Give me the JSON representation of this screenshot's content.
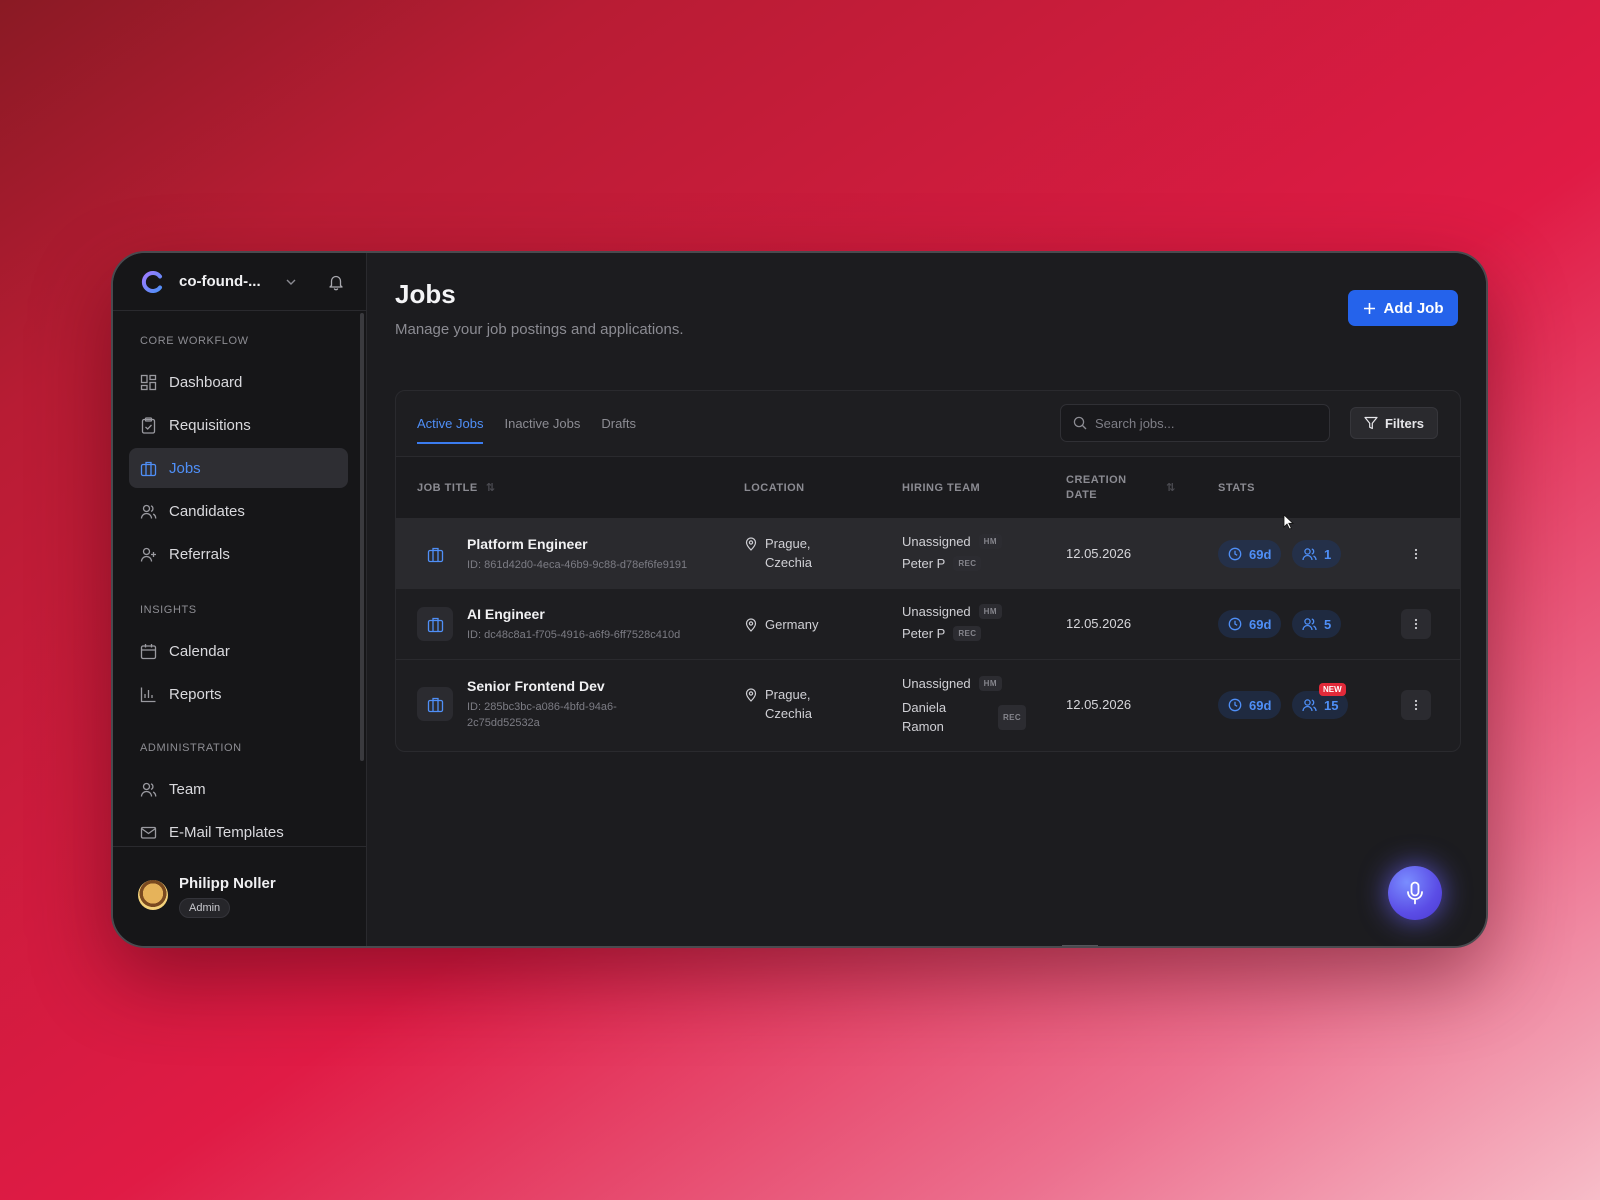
{
  "workspace": {
    "name": "co-found-..."
  },
  "sidebar": {
    "sections": [
      {
        "label": "CORE WORKFLOW",
        "items": [
          {
            "label": "Dashboard",
            "icon": "dashboard-icon"
          },
          {
            "label": "Requisitions",
            "icon": "clipboard-check-icon"
          },
          {
            "label": "Jobs",
            "icon": "briefcase-icon",
            "active": true
          },
          {
            "label": "Candidates",
            "icon": "users-icon"
          },
          {
            "label": "Referrals",
            "icon": "user-plus-icon"
          }
        ]
      },
      {
        "label": "INSIGHTS",
        "items": [
          {
            "label": "Calendar",
            "icon": "calendar-icon"
          },
          {
            "label": "Reports",
            "icon": "bar-chart-icon"
          }
        ]
      },
      {
        "label": "ADMINISTRATION",
        "items": [
          {
            "label": "Team",
            "icon": "user-icon"
          },
          {
            "label": "E-Mail Templates",
            "icon": "mail-icon"
          }
        ]
      }
    ]
  },
  "user": {
    "name": "Philipp Noller",
    "role": "Admin"
  },
  "header": {
    "title": "Jobs",
    "subtitle": "Manage your job postings and applications.",
    "add_button": "Add Job"
  },
  "tabs": [
    "Active Jobs",
    "Inactive Jobs",
    "Drafts"
  ],
  "search": {
    "placeholder": "Search jobs..."
  },
  "filters_label": "Filters",
  "table": {
    "columns": {
      "job_title": "JOB TITLE",
      "location": "LOCATION",
      "hiring_team": "HIRING TEAM",
      "creation_date_1": "CREATION",
      "creation_date_2": "DATE",
      "stats": "STATS"
    },
    "rows": [
      {
        "title": "Platform Engineer",
        "id_line1": "ID: 861d42d0-4eca-46b9-9c88-d78ef6fe9191",
        "id_line2": "",
        "location_line1": "Prague,",
        "location_line2": "Czechia",
        "hm_name": "Unassigned",
        "hm_tag": "HM",
        "rec_name1": "Peter P",
        "rec_name2": "",
        "rec_tag": "REC",
        "date": "12.05.2026",
        "days": "69d",
        "candidates": "1",
        "new": ""
      },
      {
        "title": "AI Engineer",
        "id_line1": "ID: dc48c8a1-f705-4916-a6f9-6ff7528c410d",
        "id_line2": "",
        "location_line1": "Germany",
        "location_line2": "",
        "hm_name": "Unassigned",
        "hm_tag": "HM",
        "rec_name1": "Peter P",
        "rec_name2": "",
        "rec_tag": "REC",
        "date": "12.05.2026",
        "days": "69d",
        "candidates": "5",
        "new": ""
      },
      {
        "title": "Senior Frontend Dev",
        "id_line1": "ID: 285bc3bc-a086-4bfd-94a6-",
        "id_line2": "2c75dd52532a",
        "location_line1": "Prague,",
        "location_line2": "Czechia",
        "hm_name": "Unassigned",
        "hm_tag": "HM",
        "rec_name1": "Daniela",
        "rec_name2": "Ramon",
        "rec_tag": "REC",
        "date": "12.05.2026",
        "days": "69d",
        "candidates": "15",
        "new": "NEW"
      }
    ]
  },
  "colors": {
    "accent": "#2563eb",
    "link": "#4f8ff7",
    "new_badge": "#e22a3a"
  }
}
